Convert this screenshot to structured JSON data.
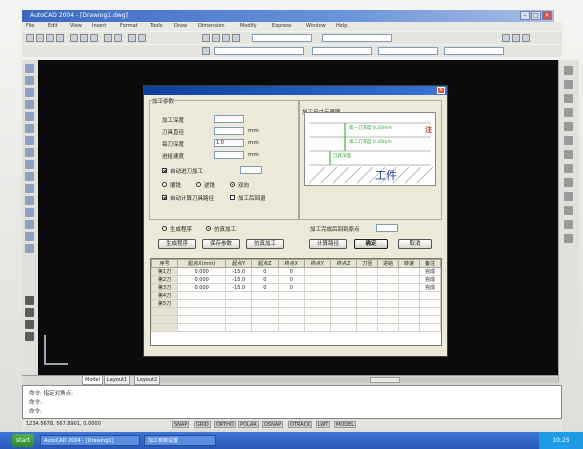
{
  "window": {
    "title": "AutoCAD 2004 - [Drawing1.dwg]"
  },
  "menubar": [
    "File",
    "Edit",
    "View",
    "Insert",
    "Format",
    "Tools",
    "Draw",
    "Dimension",
    "Modify",
    "Express",
    "Window",
    "Help"
  ],
  "dialog": {
    "title": "",
    "group_left_label": "加工参数",
    "fields": [
      {
        "label": "加工深度",
        "value": "",
        "unit": ""
      },
      {
        "label": "刀具直径",
        "value": "",
        "unit": "mm"
      },
      {
        "label": "每刀深度",
        "value": "1.0",
        "unit": "mm"
      },
      {
        "label": "进给速度",
        "value": "",
        "unit": "mm"
      }
    ],
    "options": [
      {
        "label": "自动进刀加工",
        "checked": true
      },
      {
        "label": "顺铣",
        "checked": false
      },
      {
        "label": "逆铣",
        "checked": false
      },
      {
        "label": "双向",
        "checked": true
      },
      {
        "label": "自动计算刀具路径",
        "checked": true
      },
      {
        "label": "加工后回退",
        "checked": false
      }
    ],
    "group_right_label": "加工尺寸示意图",
    "diagram_labels": {
      "workpiece": "工件",
      "dim1": "第一刀深度 0.20mm",
      "dim2": "第二刀深度 0.20mm",
      "dim3": "刀具深度",
      "warn": "注"
    },
    "radio_row": [
      {
        "label": "生成程序",
        "on": false
      },
      {
        "label": "仿真加工",
        "on": true
      }
    ],
    "check_row_label": "加工完成后回到原点",
    "buttons": {
      "calc": "计算路径",
      "ok": "确定",
      "cancel": "取消",
      "gen": "生成程序",
      "save": "保存参数",
      "sim": "仿真加工"
    },
    "table": {
      "headers": [
        "序号",
        "起点X(mm)",
        "起点Y",
        "起点Z",
        "终点X",
        "终点Y",
        "终点Z",
        "刀径",
        "进给",
        "转速",
        "备注"
      ],
      "rows": [
        [
          "第1刀",
          "0.000",
          "-15.0",
          "0",
          "0",
          "",
          "",
          "",
          "",
          "",
          "完成"
        ],
        [
          "第2刀",
          "0.000",
          "-15.0",
          "0",
          "0",
          "",
          "",
          "",
          "",
          "",
          "完成"
        ],
        [
          "第3刀",
          "0.000",
          "-15.0",
          "0",
          "0",
          "",
          "",
          "",
          "",
          "",
          "完成"
        ],
        [
          "第4刀",
          "",
          "",
          "",
          "",
          "",
          "",
          "",
          "",
          "",
          ""
        ],
        [
          "第5刀",
          "",
          "",
          "",
          "",
          "",
          "",
          "",
          "",
          "",
          ""
        ],
        [
          "",
          "",
          "",
          "",
          "",
          "",
          "",
          "",
          "",
          "",
          ""
        ],
        [
          "",
          "",
          "",
          "",
          "",
          "",
          "",
          "",
          "",
          "",
          ""
        ],
        [
          "",
          "",
          "",
          "",
          "",
          "",
          "",
          "",
          "",
          "",
          ""
        ]
      ]
    }
  },
  "tabs": [
    "Model",
    "Layout1",
    "Layout2"
  ],
  "command": {
    "lines": [
      "命令: 指定对角点:",
      "命令:",
      "命令:"
    ]
  },
  "statusbar": {
    "coords": "1234.5678, 567.8901, 0.0000",
    "buttons": [
      "SNAP",
      "GRID",
      "ORTHO",
      "POLAR",
      "OSNAP",
      "OTRACK",
      "LWT",
      "MODEL"
    ]
  },
  "taskbar": {
    "start": "start",
    "tasks": [
      "AutoCAD 2004 - [Drawing1]",
      "加工参数设置"
    ],
    "clock": "10:25"
  },
  "colors": {
    "canvas": "#0c0b0b",
    "accent": "#d62a1a",
    "dialog": "#ece9d8"
  }
}
